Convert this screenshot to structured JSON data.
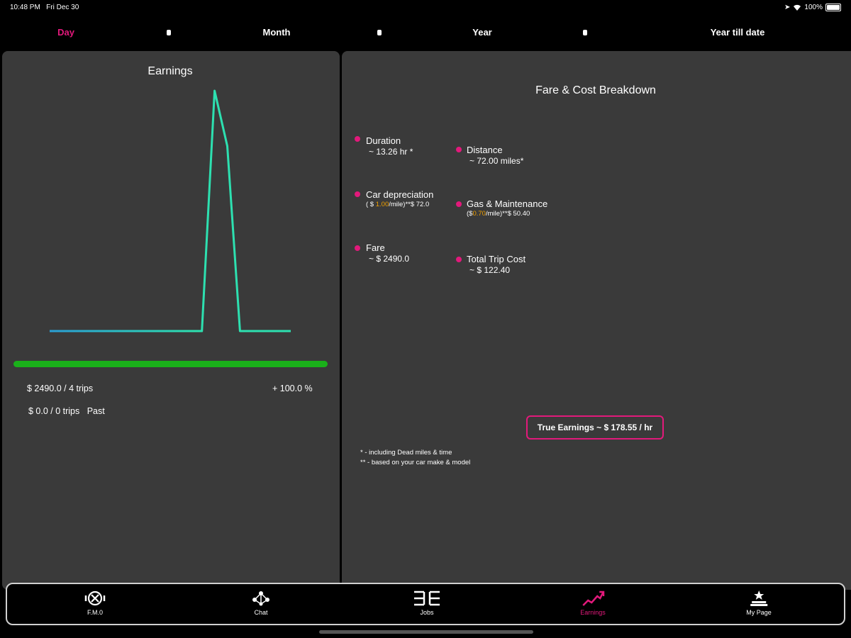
{
  "status_bar": {
    "time": "10:48 PM",
    "date": "Fri Dec 30",
    "battery": "100%"
  },
  "tabs": [
    {
      "label": "Day",
      "active": true
    },
    {
      "label": "Month",
      "active": false
    },
    {
      "label": "Year",
      "active": false
    },
    {
      "label": "Year till date",
      "active": false
    }
  ],
  "left_panel": {
    "title": "Earnings",
    "current_summary": "$ 2490.0 / 4 trips",
    "change_percent": "+ 100.0 %",
    "past_summary": "$ 0.0 / 0 trips",
    "past_label": "Past"
  },
  "chart_data": {
    "type": "line",
    "title": "",
    "series": [
      {
        "values": [
          0,
          0,
          0,
          0,
          0,
          0,
          0,
          0,
          0,
          0,
          0,
          0,
          0,
          1.0,
          0.77,
          0,
          0,
          0,
          0,
          0
        ]
      }
    ],
    "ylim": [
      0,
      1.0
    ],
    "grid": false,
    "progress_fraction": 1.0,
    "colors": {
      "line_start": "#2a9fd6",
      "line_end": "#2de0b0",
      "progress": "#1ab01a"
    }
  },
  "breakdown": {
    "title": "Fare & Cost Breakdown",
    "duration": {
      "label": "Duration",
      "value": "~ 13.26 hr *"
    },
    "distance": {
      "label": "Distance",
      "value": "~ 72.00 miles*"
    },
    "car_depreciation": {
      "label": "Car depreciation",
      "prefix": "( $ ",
      "rate": "1.00",
      "suffix": "/mile)**$ 72.0"
    },
    "gas_maintenance": {
      "label": "Gas & Maintenance",
      "prefix": "($",
      "rate": "0.70",
      "suffix": "/mile)**$ 50.40"
    },
    "fare": {
      "label": "Fare",
      "value": "~ $ 2490.0"
    },
    "total_trip_cost": {
      "label": "Total Trip Cost",
      "value": "~ $ 122.40"
    },
    "true_earnings": "True Earnings ~ $ 178.55 / hr",
    "note_1": "* - including Dead miles & time",
    "note_2": "** - based on your car make & model"
  },
  "bottom_nav": [
    {
      "label": "F.M.0",
      "icon": "fmo-icon",
      "active": false
    },
    {
      "label": "Chat",
      "icon": "chat-icon",
      "active": false
    },
    {
      "label": "Jobs",
      "icon": "jobs-icon",
      "active": false
    },
    {
      "label": "Earnings",
      "icon": "earnings-icon",
      "active": true
    },
    {
      "label": "My Page",
      "icon": "my-page-icon",
      "active": false
    }
  ],
  "colors": {
    "accent": "#e2197b",
    "panel": "#3a3a3a",
    "background": "#000000"
  }
}
